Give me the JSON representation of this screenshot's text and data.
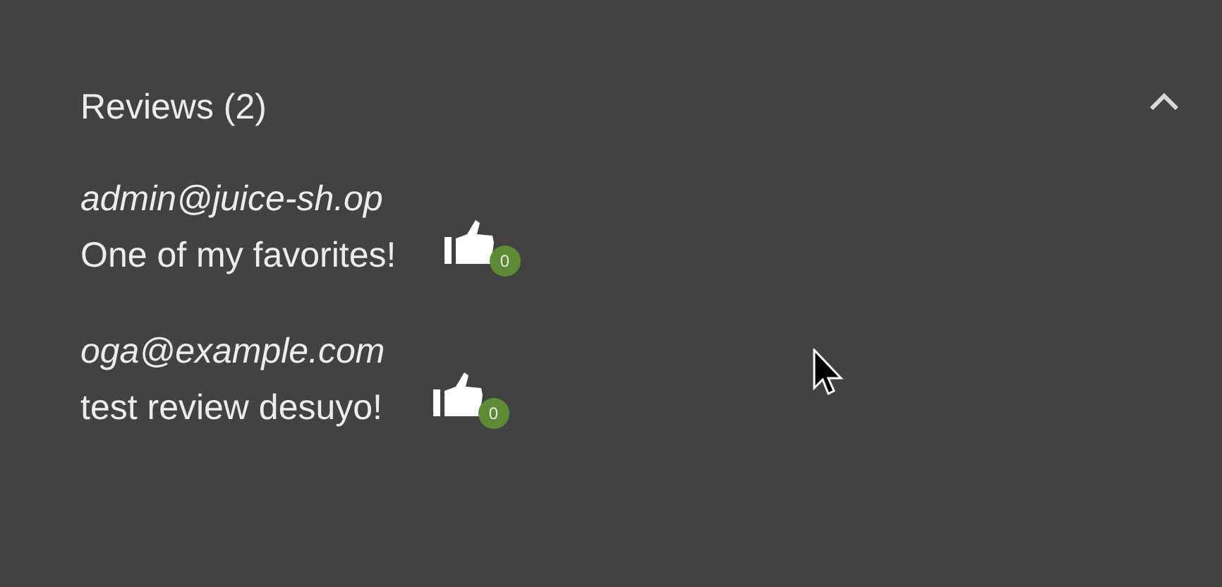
{
  "reviews_panel": {
    "title": "Reviews (2)",
    "expanded": true,
    "reviews": [
      {
        "author": "admin@juice-sh.op",
        "text": "One of my favorites!",
        "likes": "0"
      },
      {
        "author": "oga@example.com",
        "text": "test review desuyo!",
        "likes": "0"
      }
    ]
  }
}
